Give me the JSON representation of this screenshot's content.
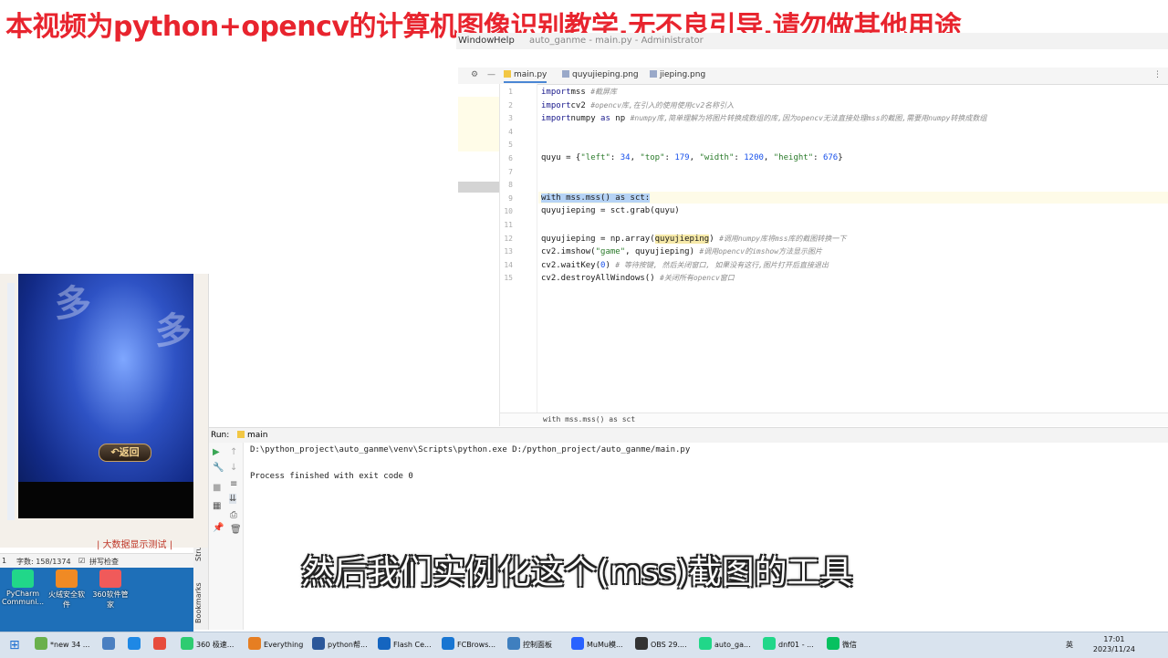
{
  "banner": "本视频为python+opencv的计算机图像识别教学,无不良引导,请勿做其他用途",
  "ide": {
    "menu": [
      "Window",
      "Help"
    ],
    "title": "auto_ganme - main.py - Administrator",
    "tabs": [
      {
        "label": "main.py",
        "active": true
      },
      {
        "label": "quyujieping.png",
        "active": false
      },
      {
        "label": "jieping.png",
        "active": false
      }
    ],
    "breadcrumb": "with mss.mss() as sct"
  },
  "code": [
    {
      "n": "1",
      "parts": [
        [
          "kw",
          "import"
        ],
        [
          "",
          "mss  "
        ],
        [
          "cmt",
          "#截屏库"
        ]
      ]
    },
    {
      "n": "2",
      "parts": [
        [
          "kw",
          "import"
        ],
        [
          "",
          "cv2   "
        ],
        [
          "cmt",
          "#opencv库,在引入的使用使用cv2名称引入"
        ]
      ]
    },
    {
      "n": "3",
      "parts": [
        [
          "kw",
          "import"
        ],
        [
          "",
          "numpy "
        ],
        [
          "kw",
          "as"
        ],
        [
          "",
          " np  "
        ],
        [
          "cmt",
          "#numpy库,简单理解为将图片转换成数组的库,因为opencv无法直接处理mss的截图,需要用numpy转换成数组"
        ]
      ]
    },
    {
      "n": "4",
      "parts": []
    },
    {
      "n": "5",
      "parts": []
    },
    {
      "n": "6",
      "parts": [
        [
          "",
          "quyu = {"
        ],
        [
          "str",
          "\"left\""
        ],
        [
          "",
          ": "
        ],
        [
          "num",
          "34"
        ],
        [
          "",
          ", "
        ],
        [
          "str",
          "\"top\""
        ],
        [
          "",
          ": "
        ],
        [
          "num",
          "179"
        ],
        [
          "",
          ", "
        ],
        [
          "str",
          "\"width\""
        ],
        [
          "",
          ": "
        ],
        [
          "num",
          "1200"
        ],
        [
          "",
          ", "
        ],
        [
          "str",
          "\"height\""
        ],
        [
          "",
          ": "
        ],
        [
          "num",
          "676"
        ],
        [
          "",
          "}"
        ]
      ]
    },
    {
      "n": "7",
      "parts": []
    },
    {
      "n": "8",
      "parts": []
    },
    {
      "n": "9",
      "parts": [
        [
          "sel",
          "with mss.mss() as sct:"
        ]
      ]
    },
    {
      "n": "10",
      "parts": [
        [
          "",
          "    quyujieping = sct.grab(quyu)"
        ]
      ]
    },
    {
      "n": "11",
      "parts": []
    },
    {
      "n": "12",
      "parts": [
        [
          "",
          "quyujieping = np.array("
        ],
        [
          "hl",
          "quyujieping"
        ],
        [
          "",
          ")  "
        ],
        [
          "cmt",
          "#调用numpy库将mss库的截图转换一下"
        ]
      ]
    },
    {
      "n": "13",
      "parts": [
        [
          "",
          "cv2.imshow("
        ],
        [
          "str",
          "\"game\""
        ],
        [
          "",
          ", quyujieping)  "
        ],
        [
          "cmt",
          "#调用opencv的imshow方法显示图片"
        ]
      ]
    },
    {
      "n": "14",
      "parts": [
        [
          "",
          "cv2.waitKey("
        ],
        [
          "num",
          "0"
        ],
        [
          "",
          ")  "
        ],
        [
          "cmt",
          "# 等待按键, 然后关闭窗口, 如果没有这行,图片打开后直接退出"
        ]
      ]
    },
    {
      "n": "15",
      "parts": [
        [
          "",
          "cv2.destroyAllWindows()  "
        ],
        [
          "cmt",
          "#关闭所有opencv窗口"
        ]
      ]
    }
  ],
  "run": {
    "label": "Run:",
    "config": "main",
    "lines": [
      "D:\\python_project\\auto_ganme\\venv\\Scripts\\python.exe D:/python_project/auto_ganme/main.py",
      "",
      "Process finished with exit code 0"
    ],
    "side_tabs": [
      "Structure",
      "Bookmarks"
    ]
  },
  "game": {
    "button": "返回",
    "watermark": "多",
    "below_text": "| 大数据显示测试 |"
  },
  "wordbar": {
    "page": "1",
    "words": "字数: 158/1374",
    "spell": "拼写检查"
  },
  "desktop_icons": [
    {
      "label": "PyCharm Communi...",
      "color": "#21d789"
    },
    {
      "label": "火绒安全软件",
      "color": "#f08a24"
    },
    {
      "label": "360软件管家",
      "color": "#f05a5a"
    }
  ],
  "subtitle": "然后我们实例化这个(mss)截图的工具",
  "taskbar": {
    "items": [
      {
        "label": "*new 34 ...",
        "color": "#6ab04c"
      },
      {
        "label": "",
        "color": "#4a7fc1"
      },
      {
        "label": "",
        "color": "#1e88e5"
      },
      {
        "label": "",
        "color": "#e74c3c"
      },
      {
        "label": "360 极速...",
        "color": "#2ecc71"
      },
      {
        "label": "Everything",
        "color": "#e67e22"
      },
      {
        "label": "python帮...",
        "color": "#2b579a"
      },
      {
        "label": "Flash Ce...",
        "color": "#1565c0"
      },
      {
        "label": "FCBrows...",
        "color": "#1976d2"
      },
      {
        "label": "控制面板",
        "color": "#3f7fbf"
      },
      {
        "label": "MuMu模...",
        "color": "#2962ff"
      },
      {
        "label": "OBS 29....",
        "color": "#333333"
      },
      {
        "label": "auto_ga...",
        "color": "#21d789"
      },
      {
        "label": "dnf01 - ...",
        "color": "#21d789"
      },
      {
        "label": "微信",
        "color": "#07c160"
      }
    ],
    "ime": "英",
    "time": "17:01",
    "date": "2023/11/24"
  }
}
